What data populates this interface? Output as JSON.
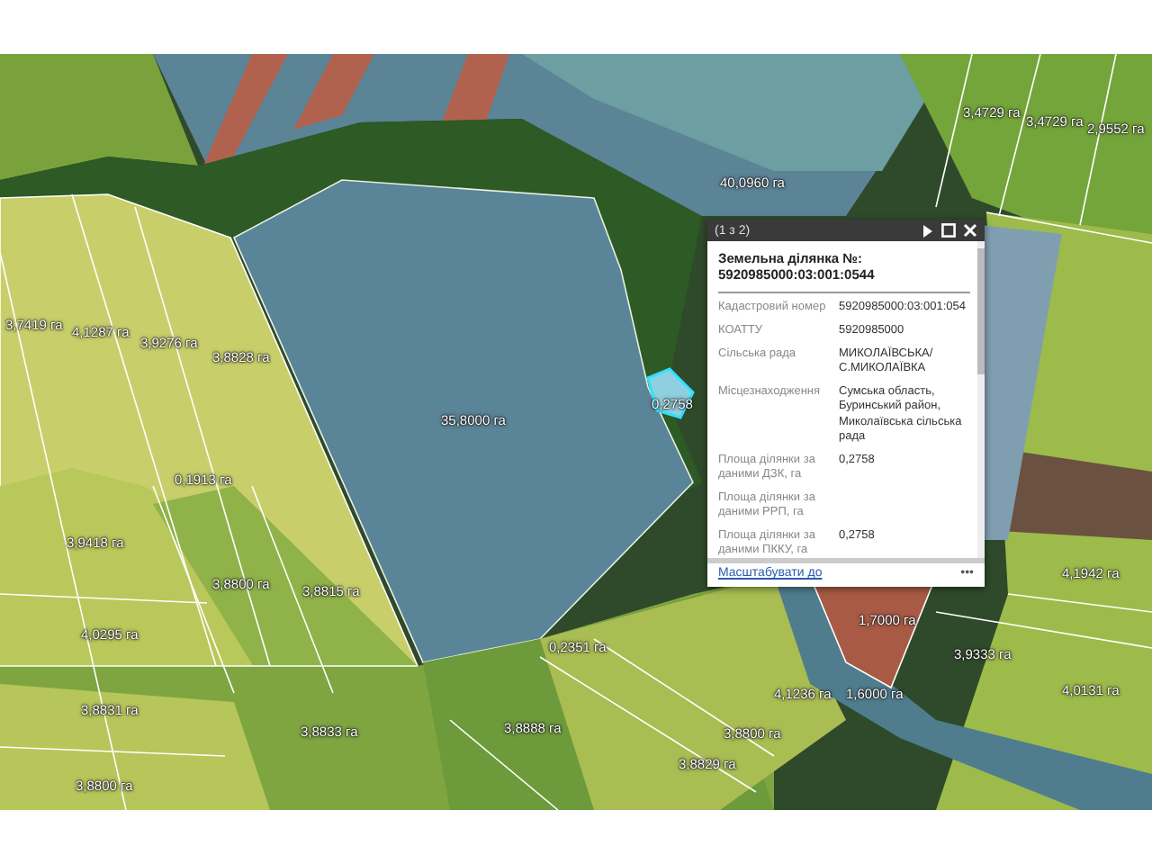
{
  "map": {
    "area_labels": [
      {
        "text": "3,4729 га"
      },
      {
        "text": "3,4729 га"
      },
      {
        "text": "2,9552 га"
      },
      {
        "text": "40,0960 га"
      },
      {
        "text": "3,7419 га"
      },
      {
        "text": "4,1287 га"
      },
      {
        "text": "3,9276 га"
      },
      {
        "text": "3,8828 га"
      },
      {
        "text": "35,8000 га"
      },
      {
        "text": "0,2758"
      },
      {
        "text": "0,1913 га"
      },
      {
        "text": "3,9418 га"
      },
      {
        "text": "3,8800 га"
      },
      {
        "text": "3,8815 га"
      },
      {
        "text": "4,1942 га"
      },
      {
        "text": "1,7000 га"
      },
      {
        "text": "4,0295 га"
      },
      {
        "text": "0,2351 га"
      },
      {
        "text": "3,9333 га"
      },
      {
        "text": "4,1236 га"
      },
      {
        "text": "1,6000 га"
      },
      {
        "text": "4,0131 га"
      },
      {
        "text": "3,8831 га"
      },
      {
        "text": "3,8833 га"
      },
      {
        "text": "3,8888 га"
      },
      {
        "text": "3,8800 га"
      },
      {
        "text": "3,8829 га"
      },
      {
        "text": "3,8800 га"
      }
    ]
  },
  "popup": {
    "counter": "(1 з 2)",
    "title": "Земельна ділянка №:",
    "number": "5920985000:03:001:0544",
    "fields": [
      {
        "label": "Кадастровий номер",
        "value": "5920985000:03:001:054"
      },
      {
        "label": "КОАТТУ",
        "value": "5920985000"
      },
      {
        "label": "Сільська рада",
        "value": "МИКОЛАЇВСЬКА/ С.МИКОЛАЇВКА"
      },
      {
        "label": "Місцезнаходження",
        "value": "Сумська область, Буринський район, Миколаївська сільська рада"
      },
      {
        "label": "Площа ділянки за даними ДЗК, га",
        "value": "0,2758"
      },
      {
        "label": "Площа ділянки за даними РРП, га"
      },
      {
        "label": "Площа ділянки за даними ПККУ, га",
        "value": "0,2758"
      }
    ],
    "zoom_link": "Масштабувати до",
    "more": "•••"
  }
}
